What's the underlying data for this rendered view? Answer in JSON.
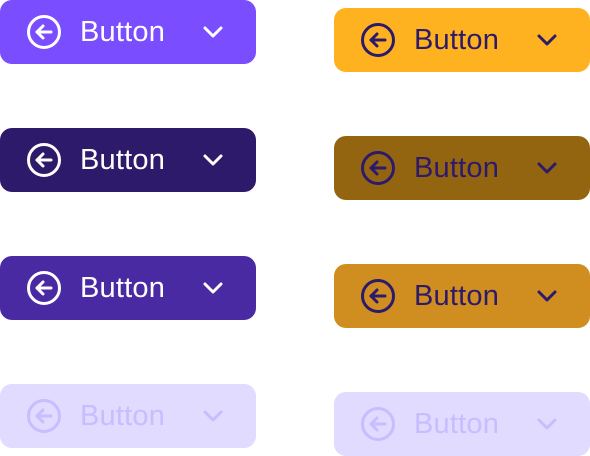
{
  "buttons": {
    "left": [
      {
        "label": "Button",
        "state": "default",
        "icon": "arrow-left-circle-icon",
        "chevron": "chevron-down-icon",
        "bg": "#7a4dff",
        "fg": "#ffffff"
      },
      {
        "label": "Button",
        "state": "pressed",
        "icon": "arrow-left-circle-icon",
        "chevron": "chevron-down-icon",
        "bg": "#2e1a6b",
        "fg": "#ffffff"
      },
      {
        "label": "Button",
        "state": "hover",
        "icon": "arrow-left-circle-icon",
        "chevron": "chevron-down-icon",
        "bg": "#4a2aa3",
        "fg": "#ffffff"
      },
      {
        "label": "Button",
        "state": "disabled",
        "icon": "arrow-left-circle-icon",
        "chevron": "chevron-down-icon",
        "bg": "#e0dbff",
        "fg": "#c7bdff"
      }
    ],
    "right": [
      {
        "label": "Button",
        "state": "default",
        "icon": "arrow-left-circle-icon",
        "chevron": "chevron-down-icon",
        "bg": "#ffb21f",
        "fg": "#2e1a6b"
      },
      {
        "label": "Button",
        "state": "pressed",
        "icon": "arrow-left-circle-icon",
        "chevron": "chevron-down-icon",
        "bg": "#946511",
        "fg": "#2e1a6b"
      },
      {
        "label": "Button",
        "state": "hover",
        "icon": "arrow-left-circle-icon",
        "chevron": "chevron-down-icon",
        "bg": "#cf8e1f",
        "fg": "#2e1a6b"
      },
      {
        "label": "Button",
        "state": "disabled",
        "icon": "arrow-left-circle-icon",
        "chevron": "chevron-down-icon",
        "bg": "#e0dbff",
        "fg": "#c7bdff"
      }
    ]
  }
}
